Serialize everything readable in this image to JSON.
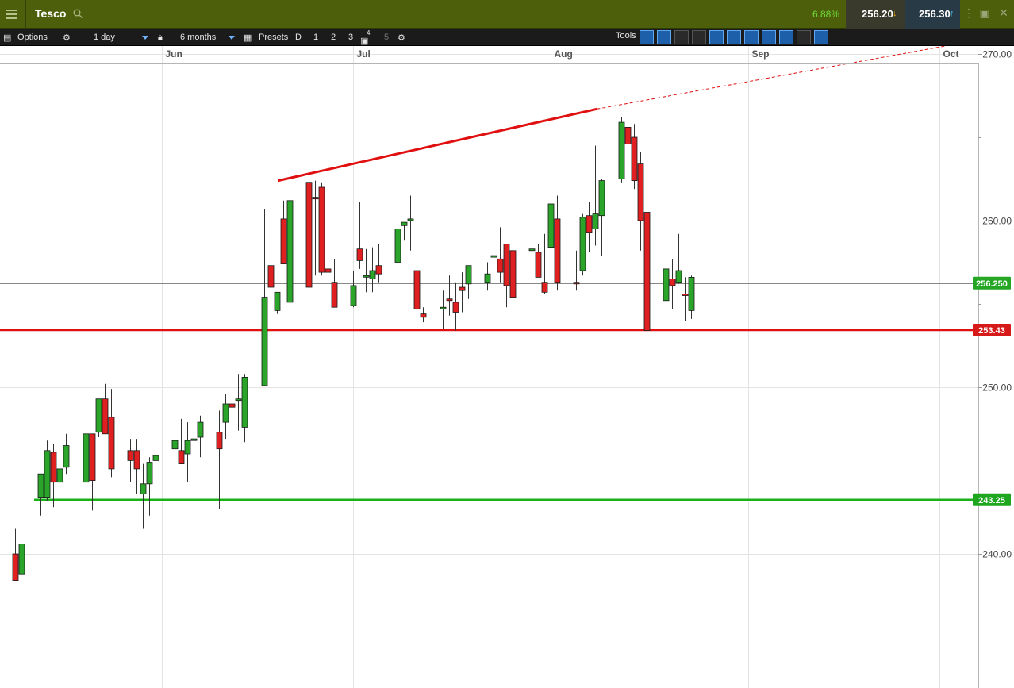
{
  "header": {
    "title": "Tesco",
    "change_pct": "6.88%",
    "sell_price": "256.20",
    "buy_price": "256.30"
  },
  "toolbar": {
    "options_label": "Options",
    "interval": "1 day",
    "period": "6 months",
    "presets_label": "Presets",
    "preset_buttons": [
      "D",
      "1",
      "2",
      "3",
      "4",
      "5"
    ],
    "tools_label": "Tools"
  },
  "colors": {
    "up": "#2aa52a",
    "down": "#e02020",
    "resistance": "#e01010",
    "support": "#19b019",
    "header_bg": "#4e5f0b"
  },
  "chart_data": {
    "type": "candlestick",
    "title": "Tesco",
    "x_labels": [
      "Jun",
      "Jul",
      "Aug",
      "Sep",
      "Oct"
    ],
    "ylim": [
      236,
      270.7
    ],
    "y_ticks": [
      240,
      250,
      260,
      270
    ],
    "y_tick_labels": [
      "240.00",
      "250.00",
      "260.00",
      "270.00"
    ],
    "grid": true,
    "price_labels": {
      "current": "256.250",
      "resistance": "253.43",
      "support": "243.25"
    },
    "levels": {
      "current": 256.25,
      "resistance": 253.43,
      "support": 243.25
    },
    "trendline": {
      "from": [
        "Jun 19",
        262.4
      ],
      "to": [
        "Aug 8",
        266.7
      ],
      "extended_to": [
        "Oct 21",
        271.8
      ]
    },
    "candles": [
      {
        "d": "May 9",
        "o": 240.0,
        "h": 241.5,
        "l": 239.0,
        "c": 238.4
      },
      {
        "d": "May 10",
        "o": 238.8,
        "h": 240.6,
        "l": 239.2,
        "c": 240.6
      },
      {
        "d": "May 13",
        "o": 243.4,
        "h": 243.8,
        "l": 242.3,
        "c": 244.8
      },
      {
        "d": "May 14",
        "o": 243.4,
        "h": 246.8,
        "l": 243.2,
        "c": 246.2
      },
      {
        "d": "May 15",
        "o": 246.1,
        "h": 246.6,
        "l": 242.8,
        "c": 244.3
      },
      {
        "d": "May 16",
        "o": 244.3,
        "h": 247.0,
        "l": 243.7,
        "c": 245.1
      },
      {
        "d": "May 17",
        "o": 245.2,
        "h": 247.2,
        "l": 244.8,
        "c": 246.5
      },
      {
        "d": "May 20",
        "o": 244.3,
        "h": 247.8,
        "l": 243.7,
        "c": 247.2
      },
      {
        "d": "May 21",
        "o": 247.2,
        "h": 247.2,
        "l": 242.6,
        "c": 244.4
      },
      {
        "d": "May 22",
        "o": 247.3,
        "h": 249.1,
        "l": 247.0,
        "c": 249.3
      },
      {
        "d": "May 23",
        "o": 249.3,
        "h": 250.2,
        "l": 247.2,
        "c": 247.2
      },
      {
        "d": "May 24",
        "o": 248.2,
        "h": 249.9,
        "l": 244.6,
        "c": 245.1
      },
      {
        "d": "May 27",
        "o": 246.2,
        "h": 246.9,
        "l": 244.3,
        "c": 245.6
      },
      {
        "d": "May 28",
        "o": 246.2,
        "h": 246.9,
        "l": 243.6,
        "c": 245.1
      },
      {
        "d": "May 29",
        "o": 243.6,
        "h": 245.4,
        "l": 241.5,
        "c": 244.2
      },
      {
        "d": "May 30",
        "o": 244.2,
        "h": 245.8,
        "l": 242.3,
        "c": 245.5
      },
      {
        "d": "May 31",
        "o": 245.6,
        "h": 248.6,
        "l": 245.3,
        "c": 245.9
      },
      {
        "d": "Jun 3",
        "o": 246.3,
        "h": 247.2,
        "l": 244.7,
        "c": 246.8
      },
      {
        "d": "Jun 4",
        "o": 246.2,
        "h": 248.1,
        "l": 245.4,
        "c": 245.4
      },
      {
        "d": "Jun 5",
        "o": 246.0,
        "h": 247.9,
        "l": 244.3,
        "c": 246.8
      },
      {
        "d": "Jun 6",
        "o": 246.8,
        "h": 247.9,
        "l": 246.3,
        "c": 246.9
      },
      {
        "d": "Jun 7",
        "o": 247.0,
        "h": 248.3,
        "l": 245.8,
        "c": 247.9
      },
      {
        "d": "Jun 10",
        "o": 247.3,
        "h": 248.6,
        "l": 242.7,
        "c": 246.3
      },
      {
        "d": "Jun 11",
        "o": 247.9,
        "h": 249.6,
        "l": 246.9,
        "c": 249.0
      },
      {
        "d": "Jun 12",
        "o": 249.0,
        "h": 249.3,
        "l": 246.2,
        "c": 248.8
      },
      {
        "d": "Jun 13",
        "o": 249.3,
        "h": 250.8,
        "l": 247.4,
        "c": 249.3
      },
      {
        "d": "Jun 14",
        "o": 247.6,
        "h": 250.8,
        "l": 246.7,
        "c": 250.6
      },
      {
        "d": "Jun 17",
        "o": 250.1,
        "h": 260.7,
        "l": 250.1,
        "c": 255.4
      },
      {
        "d": "Jun 18",
        "o": 257.3,
        "h": 257.8,
        "l": 255.4,
        "c": 256.0
      },
      {
        "d": "Jun 19",
        "o": 254.6,
        "h": 255.6,
        "l": 254.4,
        "c": 255.7
      },
      {
        "d": "Jun 20",
        "o": 260.1,
        "h": 261.2,
        "l": 257.5,
        "c": 257.4
      },
      {
        "d": "Jun 21",
        "o": 255.1,
        "h": 262.2,
        "l": 254.8,
        "c": 261.2
      },
      {
        "d": "Jun 24",
        "o": 262.3,
        "h": 262.2,
        "l": 255.7,
        "c": 256.0
      },
      {
        "d": "Jun 25",
        "o": 261.4,
        "h": 262.4,
        "l": 256.7,
        "c": 261.3
      },
      {
        "d": "Jun 26",
        "o": 262.0,
        "h": 262.3,
        "l": 256.7,
        "c": 256.9
      },
      {
        "d": "Jun 27",
        "o": 257.1,
        "h": 256.8,
        "l": 255.7,
        "c": 256.9
      },
      {
        "d": "Jun 28",
        "o": 256.3,
        "h": 257.7,
        "l": 254.8,
        "c": 254.8
      },
      {
        "d": "Jul 1",
        "o": 254.9,
        "h": 257.0,
        "l": 254.8,
        "c": 256.1
      },
      {
        "d": "Jul 2",
        "o": 258.3,
        "h": 261.1,
        "l": 257.1,
        "c": 257.6
      },
      {
        "d": "Jul 3",
        "o": 256.7,
        "h": 258.3,
        "l": 255.7,
        "c": 256.7
      },
      {
        "d": "Jul 4",
        "o": 256.5,
        "h": 258.4,
        "l": 255.7,
        "c": 257.0
      },
      {
        "d": "Jul 5",
        "o": 257.3,
        "h": 258.6,
        "l": 256.3,
        "c": 256.8
      },
      {
        "d": "Jul 8",
        "o": 257.5,
        "h": 259.4,
        "l": 256.6,
        "c": 259.5
      },
      {
        "d": "Jul 9",
        "o": 259.7,
        "h": 259.9,
        "l": 258.8,
        "c": 259.9
      },
      {
        "d": "Jul 10",
        "o": 260.1,
        "h": 261.5,
        "l": 258.2,
        "c": 260.1
      },
      {
        "d": "Jul 11",
        "o": 257.0,
        "h": 256.9,
        "l": 253.5,
        "c": 254.7
      },
      {
        "d": "Jul 12",
        "o": 254.4,
        "h": 254.8,
        "l": 253.9,
        "c": 254.2
      },
      {
        "d": "Jul 15",
        "o": 254.8,
        "h": 255.8,
        "l": 253.5,
        "c": 254.8
      },
      {
        "d": "Jul 16",
        "o": 255.3,
        "h": 256.7,
        "l": 254.3,
        "c": 255.2
      },
      {
        "d": "Jul 17",
        "o": 255.1,
        "h": 256.3,
        "l": 253.4,
        "c": 254.5
      },
      {
        "d": "Jul 18",
        "o": 256.0,
        "h": 256.9,
        "l": 254.5,
        "c": 255.8
      },
      {
        "d": "Jul 19",
        "o": 256.2,
        "h": 257.3,
        "l": 255.3,
        "c": 257.3
      },
      {
        "d": "Jul 22",
        "o": 256.3,
        "h": 257.5,
        "l": 255.8,
        "c": 256.8
      },
      {
        "d": "Jul 23",
        "o": 257.9,
        "h": 259.6,
        "l": 256.8,
        "c": 257.9
      },
      {
        "d": "Jul 24",
        "o": 257.7,
        "h": 259.6,
        "l": 256.3,
        "c": 256.9
      },
      {
        "d": "Jul 25",
        "o": 258.6,
        "h": 258.1,
        "l": 254.8,
        "c": 256.1
      },
      {
        "d": "Jul 26",
        "o": 258.2,
        "h": 258.7,
        "l": 254.9,
        "c": 255.4
      },
      {
        "d": "Jul 29",
        "o": 258.2,
        "h": 258.5,
        "l": 256.1,
        "c": 258.3
      },
      {
        "d": "Jul 30",
        "o": 258.1,
        "h": 258.6,
        "l": 256.6,
        "c": 256.6
      },
      {
        "d": "Jul 31",
        "o": 256.3,
        "h": 259.2,
        "l": 255.6,
        "c": 255.7
      },
      {
        "d": "Aug 1",
        "o": 258.4,
        "h": 260.7,
        "l": 254.7,
        "c": 261.0
      },
      {
        "d": "Aug 2",
        "o": 260.1,
        "h": 261.5,
        "l": 255.8,
        "c": 256.3
      },
      {
        "d": "Aug 5",
        "o": 256.3,
        "h": 258.2,
        "l": 255.8,
        "c": 256.2
      },
      {
        "d": "Aug 6",
        "o": 257.0,
        "h": 260.4,
        "l": 256.7,
        "c": 260.2
      },
      {
        "d": "Aug 7",
        "o": 260.3,
        "h": 261.1,
        "l": 258.1,
        "c": 259.3
      },
      {
        "d": "Aug 8",
        "o": 259.5,
        "h": 264.5,
        "l": 258.5,
        "c": 260.4
      },
      {
        "d": "Aug 9",
        "o": 260.3,
        "h": 262.5,
        "l": 257.9,
        "c": 262.4
      },
      {
        "d": "Aug 12",
        "o": 262.5,
        "h": 266.2,
        "l": 262.3,
        "c": 265.9
      },
      {
        "d": "Aug 13",
        "o": 265.6,
        "h": 267.0,
        "l": 264.4,
        "c": 264.6
      },
      {
        "d": "Aug 14",
        "o": 265.0,
        "h": 265.8,
        "l": 261.9,
        "c": 262.4
      },
      {
        "d": "Aug 15",
        "o": 263.4,
        "h": 264.1,
        "l": 258.2,
        "c": 260.0
      },
      {
        "d": "Aug 16",
        "o": 260.5,
        "h": 260.4,
        "l": 253.1,
        "c": 253.4
      },
      {
        "d": "Aug 19",
        "o": 255.2,
        "h": 257.1,
        "l": 253.8,
        "c": 257.1
      },
      {
        "d": "Aug 20",
        "o": 256.5,
        "h": 257.7,
        "l": 254.7,
        "c": 256.1
      },
      {
        "d": "Aug 21",
        "o": 256.3,
        "h": 259.2,
        "l": 256.2,
        "c": 257.0
      },
      {
        "d": "Aug 22",
        "o": 255.6,
        "h": 256.6,
        "l": 254.0,
        "c": 255.5
      },
      {
        "d": "Aug 23",
        "o": 254.6,
        "h": 256.7,
        "l": 254.1,
        "c": 256.6
      }
    ]
  }
}
